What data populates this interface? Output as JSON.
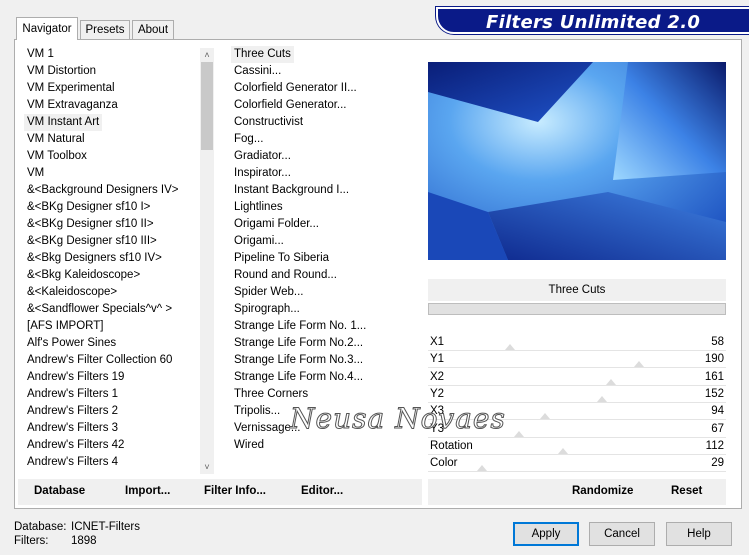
{
  "banner": {
    "title": "Filters Unlimited 2.0"
  },
  "tabs": [
    {
      "label": "Navigator",
      "active": true
    },
    {
      "label": "Presets",
      "active": false
    },
    {
      "label": "About",
      "active": false
    }
  ],
  "categories": [
    "VM 1",
    "VM Distortion",
    "VM Experimental",
    "VM Extravaganza",
    "VM Instant Art",
    "VM Natural",
    "VM Toolbox",
    "VM",
    "&<Background Designers IV>",
    "&<BKg Designer sf10 I>",
    "&<BKg Designer sf10 II>",
    "&<BKg Designer sf10 III>",
    "&<Bkg Designers sf10 IV>",
    "&<Bkg Kaleidoscope>",
    "&<Kaleidoscope>",
    "&<Sandflower Specials^v^ >",
    "[AFS IMPORT]",
    "Alf's Power Sines",
    "Andrew's Filter Collection 60",
    "Andrew's Filters 19",
    "Andrew's Filters 1",
    "Andrew's Filters 2",
    "Andrew's Filters 3",
    "Andrew's Filters 42",
    "Andrew's Filters 4"
  ],
  "selected_category": "VM Instant Art",
  "filters": [
    "Three Cuts",
    "Cassini...",
    "Colorfield Generator II...",
    "Colorfield Generator...",
    "Constructivist",
    "Fog...",
    "Gradiator...",
    "Inspirator...",
    "Instant Background I...",
    "Lightlines",
    "Origami Folder...",
    "Origami...",
    "Pipeline To Siberia",
    "Round and Round...",
    "Spider Web...",
    "Spirograph...",
    "Strange Life Form No. 1...",
    "Strange Life Form No.2...",
    "Strange Life Form No.3...",
    "Strange Life Form No.4...",
    "Three Corners",
    "Tripolis...",
    "Vernissage...",
    "Wired"
  ],
  "selected_filter": "Three Cuts",
  "left_toolbar": {
    "database": "Database",
    "import": "Import...",
    "filter_info": "Filter Info...",
    "editor": "Editor..."
  },
  "preview": {
    "filter_name": "Three Cuts"
  },
  "parameters": [
    {
      "label": "X1",
      "value": "58",
      "fraction": 0.227
    },
    {
      "label": "Y1",
      "value": "190",
      "fraction": 0.745
    },
    {
      "label": "X2",
      "value": "161",
      "fraction": 0.631
    },
    {
      "label": "Y2",
      "value": "152",
      "fraction": 0.596
    },
    {
      "label": "X3",
      "value": "94",
      "fraction": 0.369
    },
    {
      "label": "Y3",
      "value": "67",
      "fraction": 0.263
    },
    {
      "label": "Rotation",
      "value": "112",
      "fraction": 0.439
    },
    {
      "label": "Color",
      "value": "29",
      "fraction": 0.114
    }
  ],
  "right_toolbar": {
    "randomize": "Randomize",
    "reset": "Reset"
  },
  "footer": {
    "database_label": "Database:",
    "database_value": "ICNET-Filters",
    "filters_label": "Filters:",
    "filters_value": "1898"
  },
  "buttons": {
    "apply": "Apply",
    "cancel": "Cancel",
    "help": "Help"
  },
  "watermark": "Neusa Novaes",
  "colors": {
    "banner": "#0a1a88",
    "preview_dark": "#0a1e78",
    "preview_light": "#bfe8ff",
    "default_button": "#0078d7"
  }
}
